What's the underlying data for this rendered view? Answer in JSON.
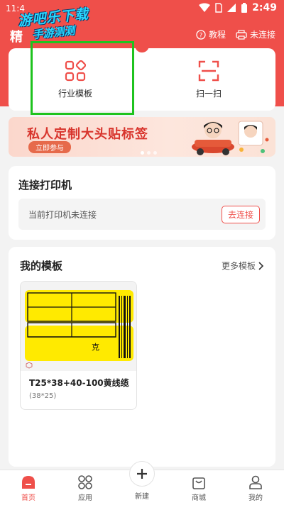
{
  "status_bar": {
    "left_time": "11:4",
    "clock": "2:49"
  },
  "watermark": {
    "line1": "游吧乐下载",
    "line2": "手游测测"
  },
  "header": {
    "title": "精",
    "tutorial_label": "教程",
    "printer_status_label": "未连接"
  },
  "features": [
    {
      "label": "行业模板",
      "icon": "grid-template-icon"
    },
    {
      "label": "扫一扫",
      "icon": "scan-icon"
    }
  ],
  "banner": {
    "title": "私人定制大头贴标签",
    "button": "立即参与",
    "active_index": 0,
    "total": 3
  },
  "printer": {
    "title": "连接打印机",
    "status": "当前打印机未连接",
    "connect_label": "去连接"
  },
  "templates": {
    "title": "我的模板",
    "more_label": "更多模板",
    "items": [
      {
        "name": "T25*38+40-100黄线缆",
        "size": "(38*25)",
        "label_text": "克",
        "label_color": "#ffea00"
      }
    ]
  },
  "bottom_nav": {
    "items": [
      {
        "label": "首页",
        "icon": "home-icon",
        "active": true
      },
      {
        "label": "应用",
        "icon": "apps-icon",
        "active": false
      },
      {
        "label": "新建",
        "icon": "plus-icon",
        "active": false
      },
      {
        "label": "商城",
        "icon": "shop-bag-icon",
        "active": false
      },
      {
        "label": "我的",
        "icon": "profile-icon",
        "active": false
      }
    ]
  },
  "colors": {
    "brand_red": "#ef4f4a",
    "highlight_green": "#1ec31e"
  }
}
